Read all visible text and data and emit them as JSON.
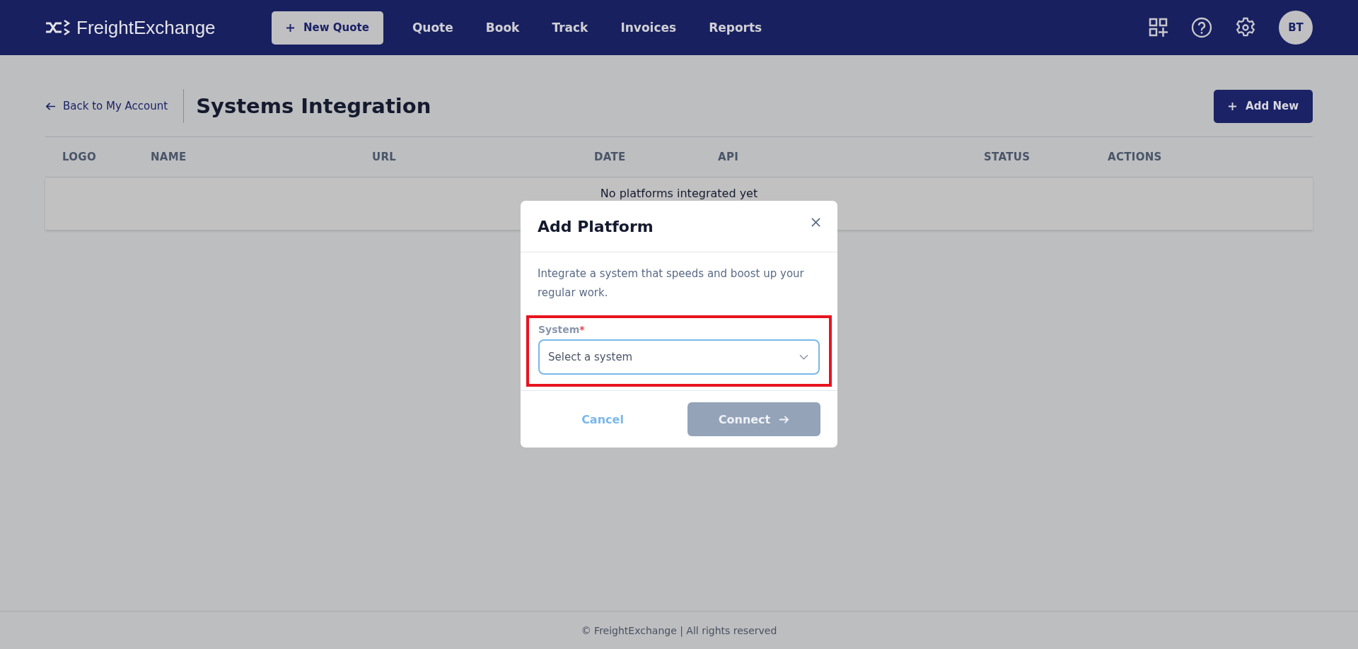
{
  "header": {
    "logo": "FreightExchange",
    "new_quote_button": "New Quote",
    "nav": [
      {
        "label": "Quote"
      },
      {
        "label": "Book"
      },
      {
        "label": "Track"
      },
      {
        "label": "Invoices"
      },
      {
        "label": "Reports"
      }
    ],
    "avatar": "BT"
  },
  "page": {
    "back_link": "Back to My Account",
    "title": "Systems Integration",
    "add_button": "Add New",
    "table": {
      "columns": [
        "LOGO",
        "NAME",
        "URL",
        "DATE",
        "API",
        "STATUS",
        "ACTIONS"
      ],
      "empty_message": "No platforms integrated yet"
    }
  },
  "modal": {
    "title": "Add Platform",
    "description": "Integrate a system that speeds and boost up your regular work.",
    "field": {
      "label": "System",
      "required_mark": "*",
      "placeholder": "Select a system",
      "focused": true,
      "highlighted": true
    },
    "cancel": "Cancel",
    "connect": {
      "label": "Connect",
      "disabled": true
    }
  },
  "footer": "© FreightExchange | All rights reserved"
}
